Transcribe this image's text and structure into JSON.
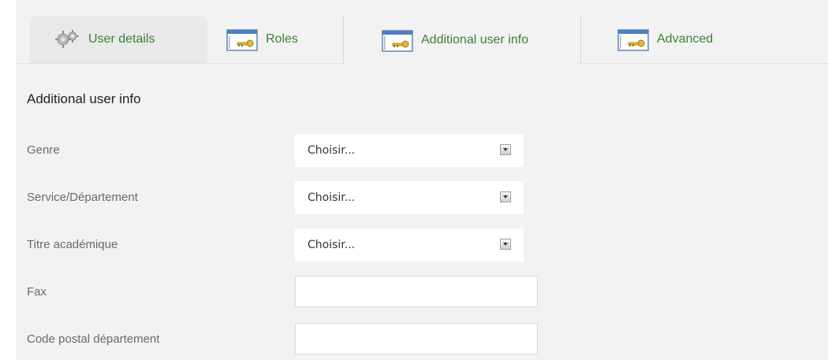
{
  "tabs": [
    {
      "label": "User details",
      "icon": "gear-icon"
    },
    {
      "label": "Roles",
      "icon": "key-window-icon"
    },
    {
      "label": "Additional user info",
      "icon": "key-window-icon"
    },
    {
      "label": "Advanced",
      "icon": "key-window-icon"
    }
  ],
  "section": {
    "title": "Additional user info"
  },
  "fields": [
    {
      "label": "Genre",
      "type": "select",
      "value": "Choisir..."
    },
    {
      "label": "Service/Département",
      "type": "select",
      "value": "Choisir..."
    },
    {
      "label": "Titre académique",
      "type": "select",
      "value": "Choisir..."
    },
    {
      "label": "Fax",
      "type": "text",
      "value": ""
    },
    {
      "label": "Code postal département",
      "type": "text",
      "value": ""
    }
  ],
  "colors": {
    "tab_text": "#3f7d3a",
    "background": "#f2f2f2"
  }
}
